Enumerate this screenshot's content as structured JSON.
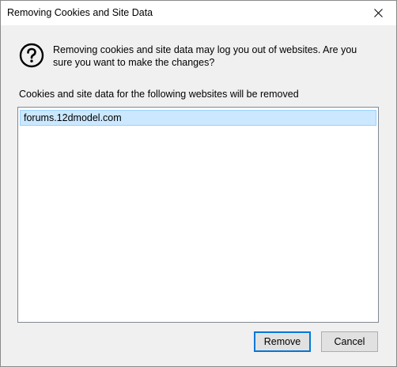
{
  "dialog": {
    "title": "Removing Cookies and Site Data",
    "message": "Removing cookies and site data may log you out of websites. Are you sure you want to make the changes?",
    "list_label": "Cookies and site data for the following websites will be removed",
    "sites": [
      "forums.12dmodel.com"
    ],
    "buttons": {
      "remove": "Remove",
      "cancel": "Cancel"
    },
    "icons": {
      "info": "question-icon",
      "close": "close-icon"
    },
    "colors": {
      "selection_bg": "#cce8ff",
      "selection_border": "#99d1ff",
      "default_button_border": "#0078d7"
    }
  }
}
